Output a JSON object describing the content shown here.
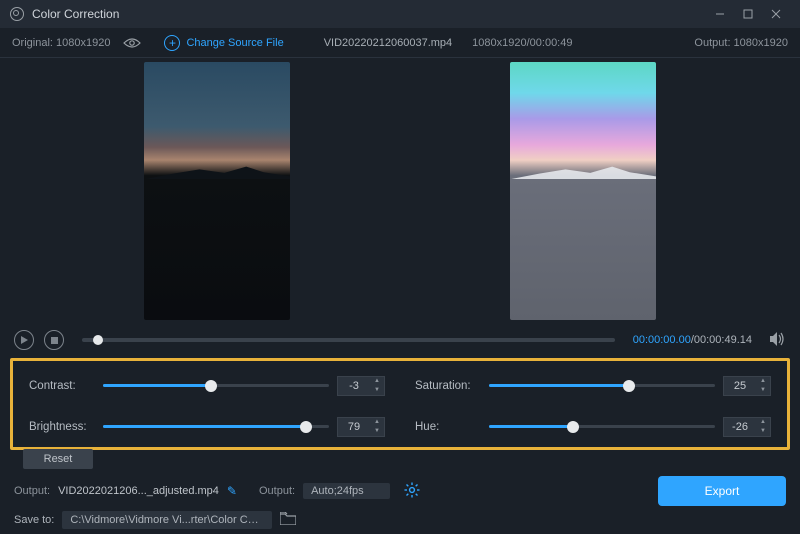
{
  "window": {
    "title": "Color Correction"
  },
  "filebar": {
    "original_label": "Original: 1080x1920",
    "change_label": "Change Source File",
    "filename": "VID20220212060037.mp4",
    "file_meta": "1080x1920/00:00:49",
    "output_label": "Output: 1080x1920"
  },
  "playback": {
    "current": "00:00:00.00",
    "total": "/00:00:49.14"
  },
  "controls": {
    "contrast": {
      "label": "Contrast:",
      "value": "-3",
      "fill_pct": 48,
      "knob_pct": 48
    },
    "brightness": {
      "label": "Brightness:",
      "value": "79",
      "fill_pct": 90,
      "knob_pct": 90
    },
    "saturation": {
      "label": "Saturation:",
      "value": "25",
      "fill_pct": 62,
      "knob_pct": 62
    },
    "hue": {
      "label": "Hue:",
      "value": "-26",
      "fill_pct": 37,
      "knob_pct": 37
    },
    "reset_label": "Reset"
  },
  "output": {
    "out_label": "Output:",
    "out_filename": "VID2022021206..._adjusted.mp4",
    "fps_label": "Output:",
    "fps_value": "Auto;24fps",
    "save_label": "Save to:",
    "save_path": "C:\\Vidmore\\Vidmore Vi...rter\\Color Correction",
    "export_label": "Export"
  }
}
